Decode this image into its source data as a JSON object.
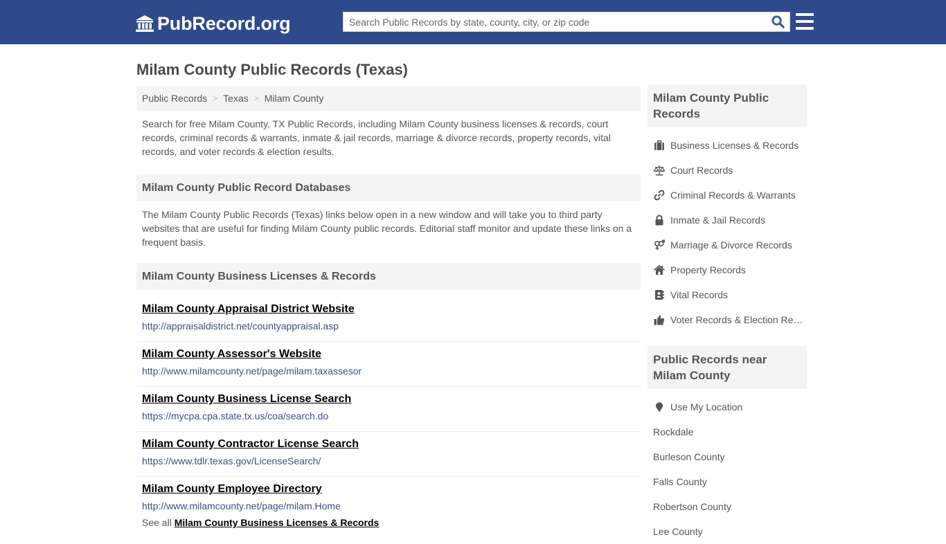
{
  "header": {
    "logo_text": "PubRecord.org",
    "logo_icon": "institution-icon",
    "search_placeholder": "Search Public Records by state, county, city, or zip code",
    "search_value": "",
    "search_icon": "search-icon",
    "menu_icon": "hamburger-menu-icon",
    "brand_color": "#2f4a8c"
  },
  "page": {
    "title": "Milam County Public Records (Texas)"
  },
  "breadcrumb": [
    {
      "label": "Public Records"
    },
    {
      "label": "Texas"
    },
    {
      "label": "Milam County"
    }
  ],
  "breadcrumb_separator": ">",
  "intro": "Search for free Milam County, TX Public Records, including Milam County business licenses & records, court records, criminal records & warrants, inmate & jail records, marriage & divorce records, property records, vital records, and voter records & election results.",
  "databases": {
    "heading": "Milam County Public Record Databases",
    "description": "The Milam County Public Records (Texas) links below open in a new window and will take you to third party websites that are useful for finding Milam County public records. Editorial staff monitor and update these links on a frequent basis."
  },
  "business": {
    "heading": "Milam County Business Licenses & Records",
    "links": [
      {
        "title": "Milam County Appraisal District Website",
        "url": "http://appraisaldistrict.net/countyappraisal.asp"
      },
      {
        "title": "Milam County Assessor's Website",
        "url": "http://www.milamcounty.net/page/milam.taxassesor"
      },
      {
        "title": "Milam County Business License Search",
        "url": "https://mycpa.cpa.state.tx.us/coa/search.do"
      },
      {
        "title": "Milam County Contractor License Search",
        "url": "https://www.tdlr.texas.gov/LicenseSearch/"
      },
      {
        "title": "Milam County Employee Directory",
        "url": "http://www.milamcounty.net/page/milam.Home"
      }
    ],
    "see_all_prefix": "See all",
    "see_all_link": "Milam County Business Licenses & Records"
  },
  "sidebar": {
    "records_heading": "Milam County Public Records",
    "records": [
      {
        "label": "Business Licenses & Records",
        "icon": "briefcase-icon"
      },
      {
        "label": "Court Records",
        "icon": "balance-scale-icon"
      },
      {
        "label": "Criminal Records & Warrants",
        "icon": "link-icon"
      },
      {
        "label": "Inmate & Jail Records",
        "icon": "lock-icon"
      },
      {
        "label": "Marriage & Divorce Records",
        "icon": "venus-mars-icon"
      },
      {
        "label": "Property Records",
        "icon": "home-icon"
      },
      {
        "label": "Vital Records",
        "icon": "address-book-icon"
      },
      {
        "label": "Voter Records & Election Results",
        "icon": "thumbs-up-icon"
      }
    ],
    "near_heading": "Public Records near Milam County",
    "use_location": {
      "label": "Use My Location",
      "icon": "map-marker-icon"
    },
    "near": [
      {
        "label": "Rockdale"
      },
      {
        "label": "Burleson County"
      },
      {
        "label": "Falls County"
      },
      {
        "label": "Robertson County"
      },
      {
        "label": "Lee County"
      }
    ]
  }
}
